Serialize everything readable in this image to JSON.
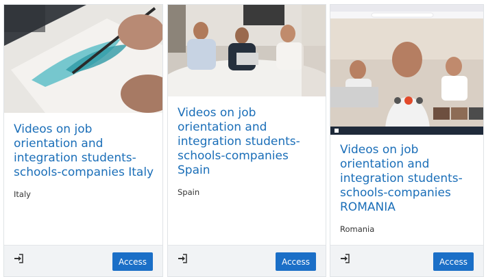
{
  "cards": [
    {
      "title": "Videos on job orientation and integration students-schools-companies Italy",
      "country": "Italy",
      "access_label": "Access"
    },
    {
      "title": "Videos on job orientation and integration students-schools-companies Spain",
      "country": "Spain",
      "access_label": "Access"
    },
    {
      "title": "Videos on job orientation and integration students-schools-companies ROMANIA",
      "country": "Romania",
      "access_label": "Access"
    }
  ],
  "colors": {
    "title": "#1a6eb8",
    "button": "#1b6fc7",
    "footer": "#f1f3f5"
  },
  "icons": {
    "enter": "sign-in-icon"
  }
}
